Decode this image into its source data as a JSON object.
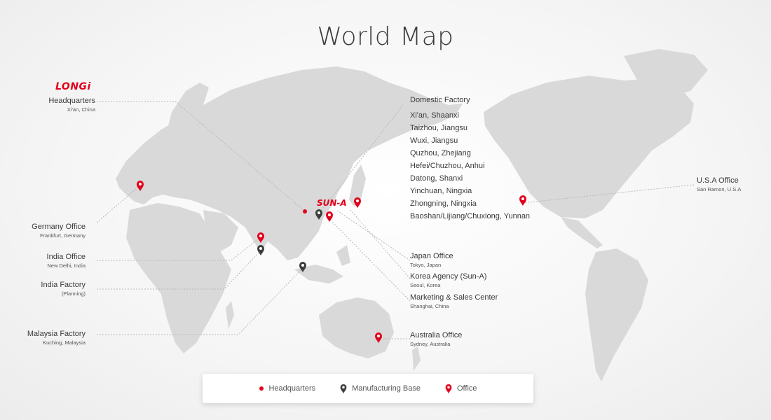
{
  "title": "World Map",
  "logo_text": "LONGi",
  "korea_logo_text": "SUN-A",
  "colors": {
    "accent": "#e3001b",
    "land": "#d9d9d9",
    "manufacturing": "#3d3d3d"
  },
  "labels": {
    "headquarters": {
      "title": "Headquarters",
      "sub": "Xi'an, China"
    },
    "germany": {
      "title": "Germany Office",
      "sub": "Frankfurt, Germany"
    },
    "india_office": {
      "title": "India Office",
      "sub": "New Delhi, India"
    },
    "india_factory": {
      "title": "India Factory",
      "sub": "(Planning)"
    },
    "malaysia": {
      "title": "Malaysia Factory",
      "sub": "Kuching, Malaysia"
    },
    "usa": {
      "title": "U.S.A Office",
      "sub": "San Ramon, U.S.A"
    },
    "japan": {
      "title": "Japan Office",
      "sub": "Tokyo, Japan"
    },
    "korea": {
      "title": "Korea Agency (Sun-A)",
      "sub": "Seoul, Korea"
    },
    "marketing": {
      "title": "Marketing & Sales Center",
      "sub": "Shanghai, China"
    },
    "australia": {
      "title": "Australia Office",
      "sub": "Sydney, Australia"
    }
  },
  "domestic": {
    "title": "Domestic Factory",
    "items": [
      "Xi'an, Shaanxi",
      "Taizhou, Jiangsu",
      "Wuxi, Jiangsu",
      "Quzhou, Zhejiang",
      "Hefei/Chuzhou, Anhui",
      "Datong, Shanxi",
      "Yinchuan, Ningxia",
      "Zhongning, Ningxia",
      "Baoshan/Lijiang/Chuxiong, Yunnan"
    ]
  },
  "legend": {
    "headquarters": "Headquarters",
    "manufacturing": "Manufacturing Base",
    "office": "Office"
  },
  "icons": {
    "headquarters": "red-dot-icon",
    "manufacturing": "dark-pin-icon",
    "office": "red-pin-icon"
  }
}
